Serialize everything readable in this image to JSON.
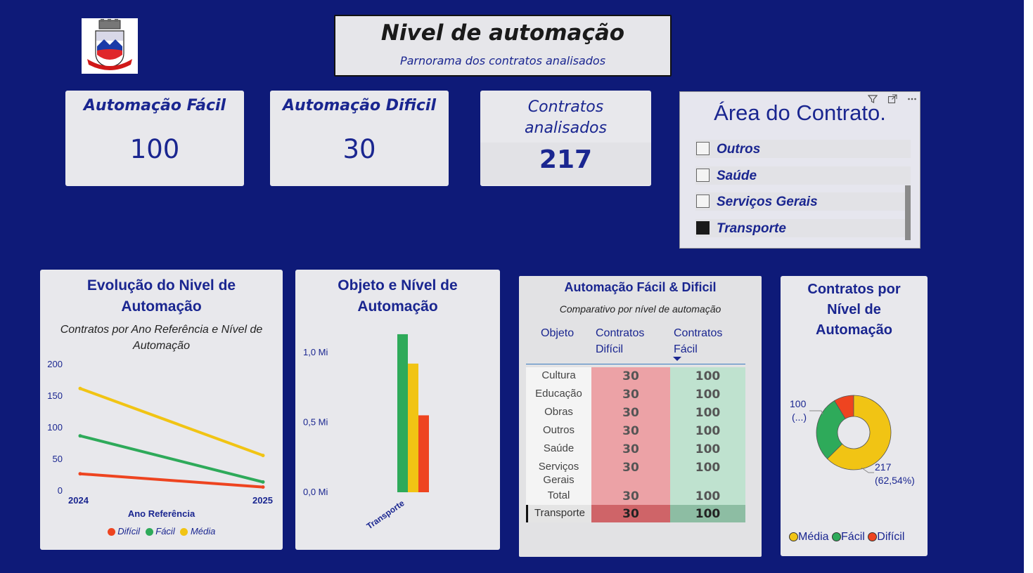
{
  "header": {
    "title": "Nivel de automação",
    "subtitle": "Parnorama dos  contratos analisados"
  },
  "kpis": {
    "facil": {
      "label": "Automação Fácil",
      "value": "100"
    },
    "dificil": {
      "label": "Automação Dificil",
      "value": "30"
    },
    "contratos": {
      "label": "Contratos analisados",
      "value": "217"
    }
  },
  "slicer": {
    "title": "Área do Contrato.",
    "items": [
      {
        "label": "Outros",
        "checked": false
      },
      {
        "label": "Saúde",
        "checked": false
      },
      {
        "label": "Serviços Gerais",
        "checked": false
      },
      {
        "label": "Transporte",
        "checked": true
      }
    ],
    "tools": {
      "filter": "filter-icon",
      "focus": "focus-mode-icon",
      "more": "more-options-icon"
    }
  },
  "colors": {
    "background": "#0e1a78",
    "dificil": "#ee4420",
    "facil": "#2eaa5a",
    "media": "#f1c414",
    "title": "#1a2690"
  },
  "chart_data": [
    {
      "type": "line",
      "title": "Evolução do Nivel de Automação",
      "subtitle": "Contratos por Ano Referência e Nível de Automação",
      "xlabel": "Ano Referência",
      "ylabel": "",
      "x": [
        "2024",
        "2025"
      ],
      "ylim": [
        0,
        200
      ],
      "yticks": [
        "0",
        "50",
        "100",
        "150",
        "200"
      ],
      "series": [
        {
          "name": "Difícil",
          "values": [
            27,
            6
          ],
          "color": "#ee4420"
        },
        {
          "name": "Fácil",
          "values": [
            87,
            14
          ],
          "color": "#2eaa5a"
        },
        {
          "name": "Média",
          "values": [
            162,
            56
          ],
          "color": "#f1c414"
        }
      ],
      "legend": "bottom",
      "grid": false
    },
    {
      "type": "bar",
      "title": "Objeto e Nível de Automação",
      "categories": [
        "Transporte"
      ],
      "ylim": [
        0,
        1.2
      ],
      "yticks": [
        "0,0 Mi",
        "0,5 Mi",
        "1,0 Mi"
      ],
      "series": [
        {
          "values": [
            1.13
          ],
          "color": "#2eaa5a"
        },
        {
          "values": [
            0.92
          ],
          "color": "#f1c414"
        },
        {
          "values": [
            0.55
          ],
          "color": "#ee4420"
        }
      ],
      "grid": false
    },
    {
      "type": "table",
      "title": "Automação Fácil & Dificil",
      "subtitle": "Comparativo  por nível de automação",
      "columns": [
        "Objeto",
        "Contratos Difícil",
        "Contratos Fácil"
      ],
      "rows": [
        [
          "Cultura",
          "30",
          "100"
        ],
        [
          "Educação",
          "30",
          "100"
        ],
        [
          "Obras",
          "30",
          "100"
        ],
        [
          "Outros",
          "30",
          "100"
        ],
        [
          "Saúde",
          "30",
          "100"
        ],
        [
          "Serviços Gerais",
          "30",
          "100"
        ],
        [
          "Total",
          "30",
          "100"
        ],
        [
          "Transporte",
          "30",
          "100"
        ]
      ]
    },
    {
      "type": "pie",
      "title": "Contratos por Nível de Automação",
      "donut": true,
      "series": [
        {
          "name": "Média",
          "value": 217,
          "percent": "62,54%",
          "color": "#f1c414"
        },
        {
          "name": "Fácil",
          "value": 100,
          "color": "#2eaa5a"
        },
        {
          "name": "Difícil",
          "value": 30,
          "color": "#ee4420"
        }
      ],
      "data_labels": {
        "media_value": "217",
        "media_pct": "(62,54%)",
        "facil_value": "100",
        "facil_pct": "(...)"
      },
      "legend": "bottom"
    }
  ]
}
